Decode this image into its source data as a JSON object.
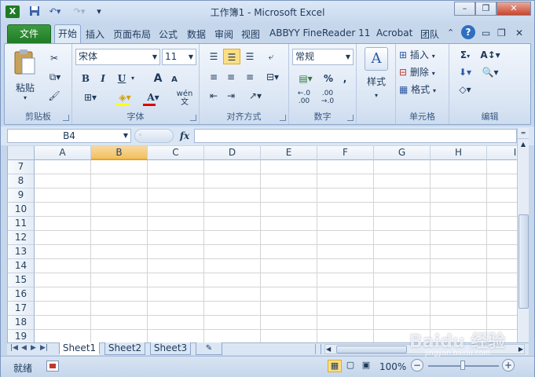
{
  "window": {
    "title": "工作簿1 - Microsoft Excel",
    "quick_access": {
      "app_icon": "excel-icon",
      "save": "save-icon",
      "undo": "undo-icon",
      "redo": "redo-icon",
      "customize": "▾"
    },
    "buttons": {
      "minimize": "–",
      "restore": "❐",
      "close": "✕"
    }
  },
  "ribbon_tabs": {
    "file": "文件",
    "items": [
      "开始",
      "插入",
      "页面布局",
      "公式",
      "数据",
      "审阅",
      "视图",
      "ABBYY FineReader 11",
      "Acrobat",
      "团队"
    ],
    "active": "开始"
  },
  "ribbon": {
    "clipboard": {
      "label": "剪贴板",
      "paste": "粘贴",
      "cut_icon": "scissors-icon",
      "copy_icon": "copy-icon",
      "format_painter_icon": "brush-icon"
    },
    "font": {
      "label": "字体",
      "font_name": "宋体",
      "font_size": "11",
      "bold": "B",
      "italic": "I",
      "underline": "U",
      "grow": "A",
      "shrink": "A",
      "phonetic": "wén 文"
    },
    "alignment": {
      "label": "对齐方式"
    },
    "number": {
      "label": "数字",
      "format": "常规",
      "percent": "%",
      "comma": ",",
      "inc_decimal": "←.0 .00",
      "dec_decimal": ".00 →.0"
    },
    "styles": {
      "label": "样式"
    },
    "cells": {
      "label": "单元格",
      "insert": "插入",
      "delete": "删除",
      "format": "格式"
    },
    "editing": {
      "label": "编辑",
      "sum": "Σ"
    }
  },
  "formula_bar": {
    "name_box": "B4",
    "fx": "fx",
    "value": ""
  },
  "grid": {
    "columns": [
      "A",
      "B",
      "C",
      "D",
      "E",
      "F",
      "G",
      "H",
      "I"
    ],
    "selected_column": "B",
    "rows": [
      "7",
      "8",
      "9",
      "10",
      "11",
      "12",
      "13",
      "14",
      "15",
      "16",
      "17",
      "18",
      "19"
    ]
  },
  "sheets": {
    "tabs": [
      "Sheet1",
      "Sheet2",
      "Sheet3"
    ],
    "active": "Sheet1",
    "insert_icon": "new-sheet-icon"
  },
  "status_bar": {
    "ready": "就绪",
    "zoom": "100%",
    "zoom_out": "−",
    "zoom_in": "+"
  },
  "watermark": {
    "text": "Baidu 经验",
    "sub": "jingyan.baidu.com"
  }
}
